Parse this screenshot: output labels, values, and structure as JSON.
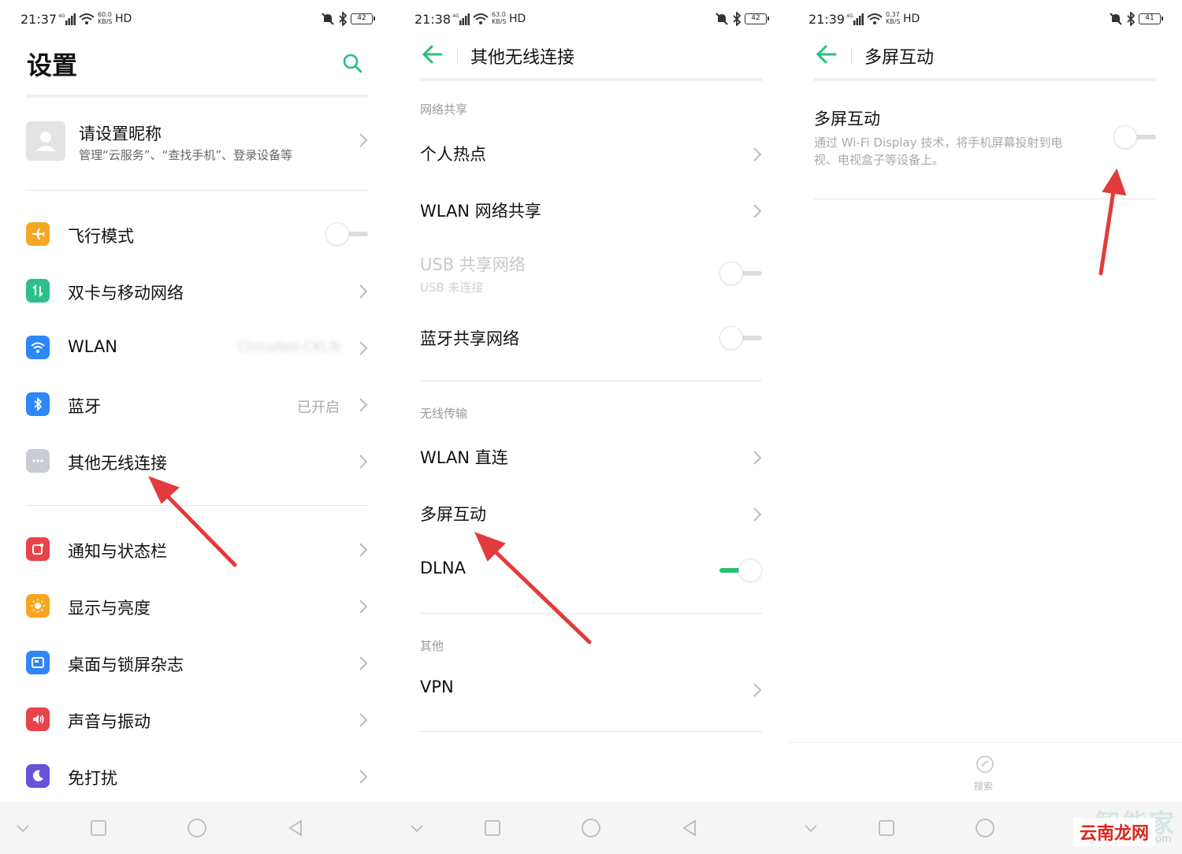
{
  "colors": {
    "accent": "#2bbf7a",
    "annotation_arrow": "#e23b3b"
  },
  "panel1": {
    "status": {
      "time": "21:37",
      "net": "4G",
      "speed_top": "60.0",
      "speed_bottom": "KB/S",
      "hd": "HD",
      "battery": "42"
    },
    "title": "设置",
    "search_icon": "search-icon",
    "profile": {
      "name": "请设置昵称",
      "sub": "管理“云服务”、“查找手机”、登录设备等"
    },
    "items": [
      {
        "label": "飞行模式",
        "icon": "airplane-icon",
        "color": "#f5a623",
        "toggle": "off"
      },
      {
        "label": "双卡与移动网络",
        "icon": "sim-icon",
        "color": "#2bc08a"
      },
      {
        "label": "WLAN",
        "icon": "wifi-icon",
        "color": "#2f86f6",
        "value": "ChinaNet-CKLN"
      },
      {
        "label": "蓝牙",
        "icon": "bluetooth-icon",
        "color": "#2f86f6",
        "value": "已开启"
      },
      {
        "label": "其他无线连接",
        "icon": "more-icon",
        "color": "#c9ccd3"
      },
      {
        "label": "通知与状态栏",
        "icon": "notification-icon",
        "color": "#e8434b"
      },
      {
        "label": "显示与亮度",
        "icon": "brightness-icon",
        "color": "#f5a623"
      },
      {
        "label": "桌面与锁屏杂志",
        "icon": "wallpaper-icon",
        "color": "#2f86f6"
      },
      {
        "label": "声音与振动",
        "icon": "sound-icon",
        "color": "#e8434b"
      },
      {
        "label": "免打扰",
        "icon": "moon-icon",
        "color": "#6752d9"
      }
    ]
  },
  "panel2": {
    "status": {
      "time": "21:38",
      "net": "4G",
      "speed_top": "63.0",
      "speed_bottom": "KB/S",
      "hd": "HD",
      "battery": "42"
    },
    "title": "其他无线连接",
    "section_share": "网络共享",
    "hotspot": "个人热点",
    "wlan_share": "WLAN 网络共享",
    "usb_share": "USB 共享网络",
    "usb_sub": "USB 未连接",
    "bt_share": "蓝牙共享网络",
    "section_wireless": "无线传输",
    "wlan_direct": "WLAN 直连",
    "multiscreen": "多屏互动",
    "dlna": "DLNA",
    "section_other": "其他",
    "vpn": "VPN"
  },
  "panel3": {
    "status": {
      "time": "21:39",
      "net": "4G",
      "speed_top": "0.37",
      "speed_bottom": "KB/S",
      "hd": "HD",
      "battery": "41"
    },
    "title": "多屏互动",
    "item_label": "多屏互动",
    "item_desc": "通过 Wi-Fi Display 技术，将手机屏幕投射到电视、电视盒子等设备上。",
    "bottom_search": "搜索"
  },
  "watermark": {
    "faint": "智能家",
    "red": "云南龙网",
    "domain": "om"
  }
}
